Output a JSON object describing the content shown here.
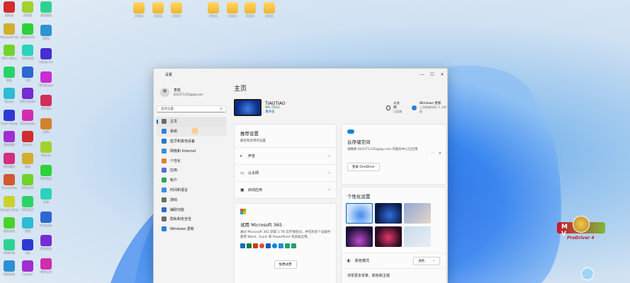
{
  "desktop": {
    "col1": [
      "回收站",
      "Microsoft Edge",
      "WPS Office",
      "微信",
      "Steam",
      "Clash Verge",
      "百度网盘",
      "WPS图片",
      "Everything",
      "Google Chrome",
      "腾讯会议",
      "哔哩哔哩",
      "网易有道"
    ],
    "col2": [
      "此电脑",
      "新建文件夹",
      "WPS表格",
      "飞书",
      "OBS Studio",
      "BCompare",
      "Screen",
      "剪映",
      "WPS文字",
      "WPS文字",
      "迅雷",
      "QQ",
      "CapCut"
    ],
    "col3": [
      "控制面板",
      "IDEA",
      "Adobe Au",
      "Wallpaper",
      "NVIDIA",
      "OBS",
      "Photos",
      "WPS演示",
      "文档",
      "Snipaste",
      "WPS演示",
      "WPS文字"
    ],
    "top_folders": [
      "文件夹",
      "文件夹",
      "文件夹",
      "文件夹",
      "文件夹",
      "文件夹",
      "文件夹"
    ]
  },
  "window": {
    "title": "设置",
    "minimize": "—",
    "maximize": "☐",
    "close": "✕"
  },
  "profile": {
    "name": "李凯",
    "email": "843371335@qq.com"
  },
  "search": {
    "placeholder": "查找设置"
  },
  "nav": [
    {
      "label": "主页",
      "color": "#6b6b6b"
    },
    {
      "label": "系统",
      "color": "#2f7fd9"
    },
    {
      "label": "蓝牙和其他设备",
      "color": "#2477d4"
    },
    {
      "label": "网络和 Internet",
      "color": "#3a8fd6"
    },
    {
      "label": "个性化",
      "color": "#e0823b"
    },
    {
      "label": "应用",
      "color": "#5a6fd1"
    },
    {
      "label": "帐户",
      "color": "#2fa35f"
    },
    {
      "label": "时间和语言",
      "color": "#3d8fe0"
    },
    {
      "label": "游戏",
      "color": "#6b6b6b"
    },
    {
      "label": "辅助功能",
      "color": "#2a6fc0"
    },
    {
      "label": "隐私和安全性",
      "color": "#6b6b6b"
    },
    {
      "label": "Windows 更新",
      "color": "#2b7fd6"
    }
  ],
  "main": {
    "title": "主页",
    "device": {
      "name": "TIAOTIAO",
      "model": "MS-7D22",
      "rename": "重命名"
    },
    "ethernet": {
      "title": "以太网",
      "sub": "已连接"
    },
    "update": {
      "title": "Windows 更新",
      "sub": "上次检查时间: 1 小时前"
    },
    "recommended": {
      "title": "推荐设置",
      "sub": "最近和常用的设置",
      "items": [
        "声音",
        "以太网",
        "启动应用"
      ]
    },
    "m365": {
      "title": "试用 Microsoft 365",
      "desc": "通过 Microsoft 365 获取 1 TB 云存储空间，并在跨多个设备时使用 Word、Excel 和 PowerPoint 等高级应用。",
      "button": "免费试用"
    },
    "cloud": {
      "title": "云存储空间",
      "desc": "请确保 843371335@qq.com 的备份中心已启用",
      "button": "登录 OneDrive"
    },
    "personalize": {
      "title": "个性化设置",
      "color_mode_label": "颜色模式",
      "color_mode_value": "浅色",
      "browse_label": "浏览更多背景、颜色和主题"
    }
  },
  "watermark": {
    "brand": "ProDriver 4",
    "letters": "M V"
  },
  "colors": {
    "accent": "#0067c0",
    "window_bg": "#f3f3f3",
    "card_bg": "#fbfbfb"
  }
}
